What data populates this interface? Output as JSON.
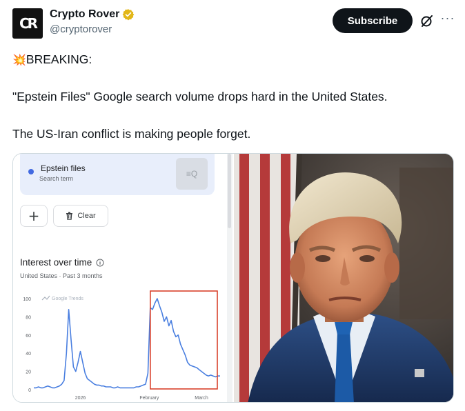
{
  "author": {
    "display_name": "Crypto Rover",
    "handle": "@cryptorover",
    "avatar_text": "CR",
    "verified_badge_color": "#e2b719"
  },
  "actions": {
    "subscribe_label": "Subscribe",
    "grok_icon": "grok-icon",
    "more_icon": "more-icon"
  },
  "tweet": {
    "line1_emoji": "💥",
    "line1_text": "BREAKING:",
    "line2": "\"Epstein Files\" Google search volume drops hard in the United States.",
    "line3": "The US-Iran conflict is making people forget."
  },
  "trends_panel": {
    "term_name": "Epstein files",
    "term_sub": "Search term",
    "add_label": "+",
    "clear_label": "Clear",
    "chart_title": "Interest over time",
    "chart_subtitle": "United States · Past 3 months",
    "watermark": "Google Trends",
    "accent": "#4a7fe0",
    "highlight_color": "#d9412b"
  },
  "chart_data": {
    "type": "line",
    "title": "Interest over time",
    "yticks": [
      0,
      20,
      40,
      60,
      80,
      100
    ],
    "ylim": [
      0,
      100
    ],
    "xticks": [
      "2026",
      "February",
      "March"
    ],
    "series": [
      {
        "values": [
          2,
          2,
          3,
          2,
          2,
          3,
          4,
          3,
          2,
          2,
          3,
          4,
          6,
          10,
          40,
          88,
          55,
          25,
          20,
          30,
          42,
          30,
          18,
          12,
          10,
          8,
          6,
          5,
          5,
          4,
          4,
          3,
          3,
          3,
          2,
          2,
          3,
          2,
          2,
          2,
          2,
          2,
          2,
          2,
          3,
          3,
          4,
          5,
          6,
          18,
          90,
          88,
          95,
          100,
          92,
          85,
          75,
          80,
          70,
          76,
          64,
          58,
          60,
          50,
          44,
          38,
          30,
          27,
          26,
          25,
          24,
          22,
          20,
          18,
          16,
          15,
          16,
          15,
          14,
          15,
          15
        ]
      }
    ]
  }
}
